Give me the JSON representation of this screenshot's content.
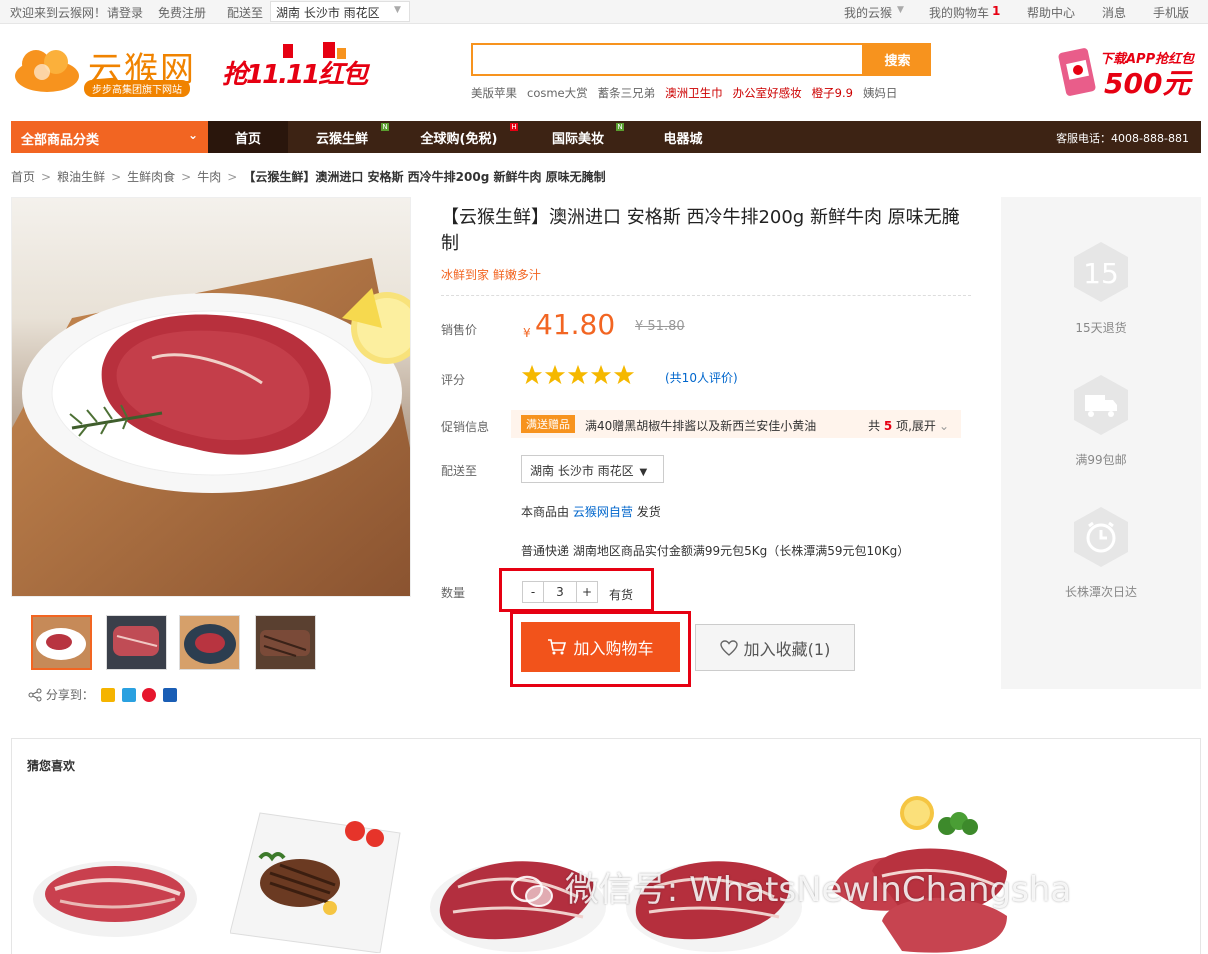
{
  "topbar": {
    "welcome": "欢迎来到云猴网！",
    "login": "请登录",
    "register": "免费注册",
    "ship_to_label": "配送至",
    "location": "湖南  长沙市  雨花区",
    "my_account": "我的云猴",
    "my_cart": "我的购物车",
    "cart_count": "1",
    "help": "帮助中心",
    "messages": "消息",
    "mobile": "手机版"
  },
  "header": {
    "logo_text": "云猴网",
    "logo_sub": "步步高集团旗下网站",
    "promo_text": "抢11.11红包",
    "search_button": "搜索",
    "search_placeholder": "",
    "hot_words": [
      {
        "text": "美版苹果",
        "red": false
      },
      {
        "text": "cosme大赏",
        "red": false
      },
      {
        "text": "蓄条三兄弟",
        "red": false
      },
      {
        "text": "澳洲卫生巾",
        "red": true
      },
      {
        "text": "办公室好感妆",
        "red": true
      },
      {
        "text": "橙子9.9",
        "red": true
      },
      {
        "text": "姨妈日",
        "red": false
      }
    ],
    "app_promo_line1": "下载APP抢红包",
    "app_promo_line2": "500元"
  },
  "nav": {
    "all_categories": "全部商品分类",
    "items": [
      "首页",
      "云猴生鲜",
      "全球购(免税)",
      "国际美妆",
      "电器城"
    ],
    "badges": [
      "N",
      "H",
      "N"
    ],
    "phone": "客服电话：4008-888-881"
  },
  "breadcrumb": [
    "首页",
    "粮油生鲜",
    "生鲜肉食",
    "牛肉",
    "【云猴生鲜】澳洲进口 安格斯 西冷牛排200g 新鲜牛肉 原味无腌制"
  ],
  "product": {
    "title": "【云猴生鲜】澳洲进口 安格斯 西冷牛排200g 新鲜牛肉 原味无腌制",
    "subtitle": "冰鲜到家 鲜嫩多汁",
    "price_label": "销售价",
    "currency": "¥",
    "price": "41.80",
    "old_price": "¥ 51.80",
    "rating_label": "评分",
    "rating_stars": 5,
    "review_count": "(共10人评价)",
    "promo_label": "促销信息",
    "promo_tag": "满送赠品",
    "promo_desc": "满40赠黑胡椒牛排酱以及新西兰安佳小黄油",
    "promo_more_prefix": "共",
    "promo_more_count": "5",
    "promo_more_suffix": "项,展开",
    "delivery_label": "配送至",
    "delivery_location": "湖南  长沙市  雨花区",
    "seller_prefix": "本商品由",
    "seller_name": "云猴网自营",
    "seller_suffix": "发货",
    "shipping_note": "普通快递 湖南地区商品实付金额满99元包5Kg（长株潭满59元包10Kg）",
    "qty_label": "数量",
    "qty_minus": "-",
    "qty_value": "3",
    "qty_plus": "+",
    "stock": "有货",
    "add_to_cart": "加入购物车",
    "add_to_fav": "加入收藏(1)",
    "share_label": "分享到："
  },
  "services": [
    {
      "icon": "15",
      "label": "15天退货"
    },
    {
      "icon": "truck-icon",
      "label": "满99包邮"
    },
    {
      "icon": "clock-icon",
      "label": "长株潭次日达"
    }
  ],
  "guess": {
    "title": "猜您喜欢"
  },
  "watermark": "微信号: WhatsNewInChangsha",
  "colors": {
    "accent": "#f26522",
    "nav_bg": "#3d2314",
    "highlight_red": "#e60012",
    "price": "#f26522"
  }
}
